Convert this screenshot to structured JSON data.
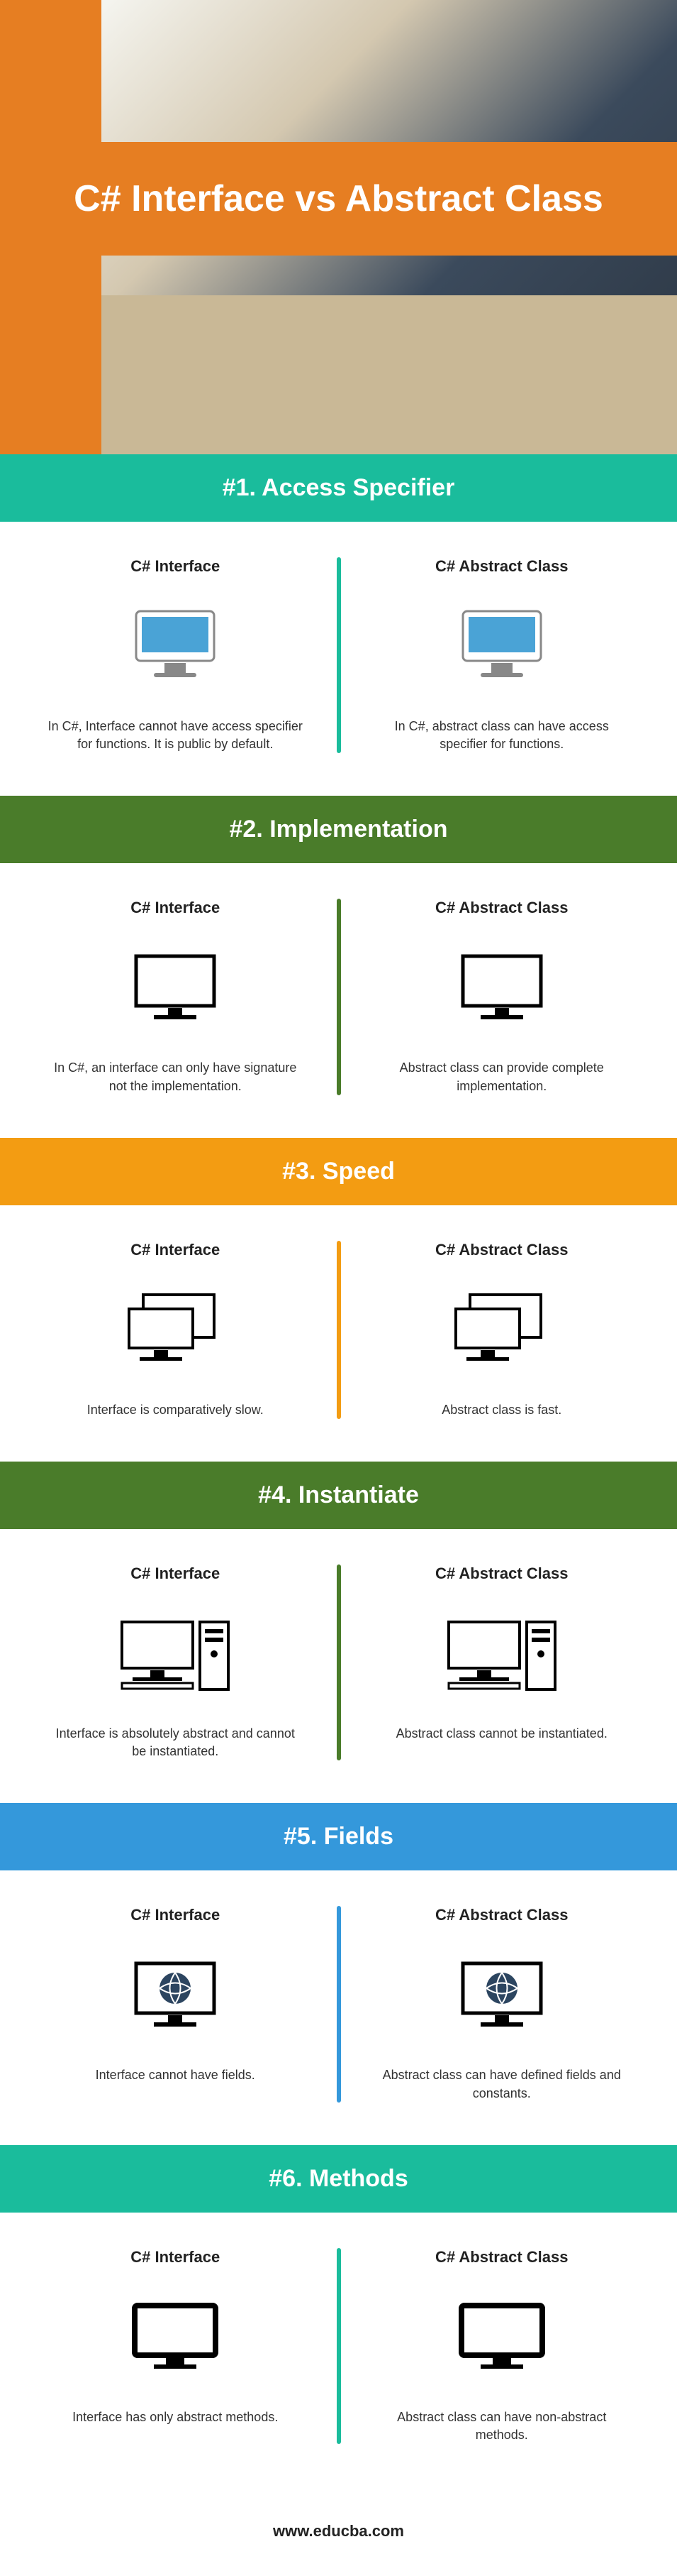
{
  "hero": {
    "title": "C# Interface vs Abstract Class"
  },
  "sections": [
    {
      "header": "#1. Access Specifier",
      "left_title": "C# Interface",
      "right_title": "C# Abstract Class",
      "left_text": "In C#, Interface cannot have access specifier for functions. It is public by default.",
      "right_text": "In C#, abstract class can have access specifier for functions."
    },
    {
      "header": "#2. Implementation",
      "left_title": "C# Interface",
      "right_title": "C# Abstract Class",
      "left_text": "In C#, an interface can only have signature not the implementation.",
      "right_text": "Abstract class can provide complete implementation."
    },
    {
      "header": "#3. Speed",
      "left_title": "C# Interface",
      "right_title": "C# Abstract Class",
      "left_text": "Interface is comparatively slow.",
      "right_text": "Abstract class is fast."
    },
    {
      "header": "#4. Instantiate",
      "left_title": "C# Interface",
      "right_title": "C# Abstract Class",
      "left_text": "Interface is absolutely abstract and cannot be instantiated.",
      "right_text": "Abstract class cannot be instantiated."
    },
    {
      "header": "#5. Fields",
      "left_title": "C# Interface",
      "right_title": "C# Abstract Class",
      "left_text": "Interface cannot have fields.",
      "right_text": "Abstract class can have defined fields and constants."
    },
    {
      "header": "#6. Methods",
      "left_title": "C# Interface",
      "right_title": "C# Abstract Class",
      "left_text": "Interface has only abstract methods.",
      "right_text": "Abstract class can have non-abstract methods."
    }
  ],
  "footer": {
    "url": "www.educba.com"
  },
  "chart_data": {
    "type": "table",
    "title": "C# Interface vs Abstract Class",
    "categories": [
      "Access Specifier",
      "Implementation",
      "Speed",
      "Instantiate",
      "Fields",
      "Methods"
    ],
    "series": [
      {
        "name": "C# Interface",
        "values": [
          "Cannot have access specifier for functions. Public by default.",
          "Can only have signature not the implementation.",
          "Comparatively slow.",
          "Absolutely abstract and cannot be instantiated.",
          "Cannot have fields.",
          "Has only abstract methods."
        ]
      },
      {
        "name": "C# Abstract Class",
        "values": [
          "Can have access specifier for functions.",
          "Can provide complete implementation.",
          "Fast.",
          "Cannot be instantiated.",
          "Can have defined fields and constants.",
          "Can have non-abstract methods."
        ]
      }
    ]
  }
}
